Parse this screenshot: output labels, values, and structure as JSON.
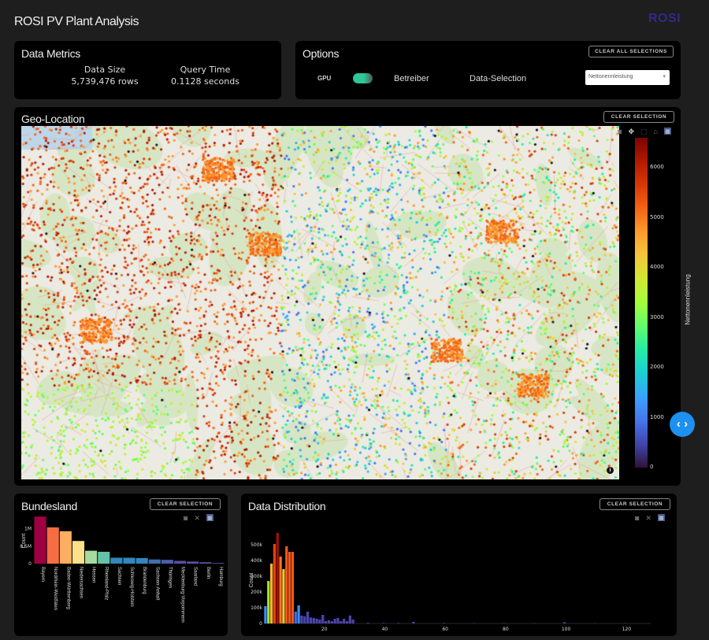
{
  "app": {
    "title": "ROSI PV Plant Analysis",
    "logo": "ROSI",
    "logo_color": "#2f2a8a"
  },
  "metrics": {
    "title": "Data Metrics",
    "data_size_label": "Data Size",
    "data_size_value": "5,739,476 rows",
    "query_time_label": "Query Time",
    "query_time_value": "0.1128 seconds"
  },
  "options": {
    "title": "Options",
    "clear_all": "CLEAR ALL SELECTIONS",
    "gpu_label": "GPU",
    "gpu_enabled": true,
    "toggle_color": "#2fc79a",
    "betreiber_label": "Betreiber",
    "data_selection_label": "Data-Selection",
    "dropdown_value": "Nettonennleistung"
  },
  "geo": {
    "title": "Geo-Location",
    "clear": "CLEAR SELECTION",
    "colorbar": {
      "title": "Nettonennleistung",
      "ticks": [
        "0",
        "1000",
        "2000",
        "3000",
        "4000",
        "5000",
        "6000"
      ],
      "range": [
        0,
        6600
      ],
      "colorscale": "turbo"
    },
    "info_icon": "info-icon"
  },
  "bundesland": {
    "title": "Bundesland",
    "clear": "CLEAR SELECTION"
  },
  "distribution": {
    "title": "Data Distribution",
    "clear": "CLEAR SELECTION"
  },
  "chart_data": [
    {
      "type": "bar",
      "title": "Bundesland",
      "ylabel": "Count",
      "ytick_labels": [
        "0",
        "0.5M",
        "1M"
      ],
      "ylim": [
        0,
        1400000
      ],
      "categories": [
        "Bayern",
        "Nordrhein-Westfalen",
        "Baden-Württemberg",
        "Niedersachsen",
        "Hessen",
        "Rheinland-Pfalz",
        "Sachsen",
        "Schleswig-Holstein",
        "Brandenburg",
        "Sachsen-Anhalt",
        "Thüringen",
        "Mecklenburg-Vorpommern",
        "Saarland",
        "Berlin",
        "Hamburg"
      ],
      "values": [
        1350000,
        1040000,
        930000,
        650000,
        370000,
        340000,
        170000,
        170000,
        160000,
        120000,
        110000,
        80000,
        60000,
        40000,
        20000
      ],
      "colors": [
        "#9e0142",
        "#f46d43",
        "#fdae61",
        "#fee08b",
        "#a6dba0",
        "#66c2a5",
        "#3288bd",
        "#3288bd",
        "#3288bd",
        "#3f6fb0",
        "#4a5fa8",
        "#5450a0",
        "#5e4fa2",
        "#5e4fa2",
        "#5e4fa2"
      ]
    },
    {
      "type": "bar",
      "title": "Data Distribution",
      "ylabel": "Count",
      "xlim": [
        0,
        128
      ],
      "ylim": [
        0,
        600000
      ],
      "xticks": [
        20,
        40,
        60,
        80,
        100,
        120
      ],
      "yticks": [
        0,
        100000,
        200000,
        300000,
        400000,
        500000
      ],
      "ytick_labels": [
        "0",
        "100k",
        "200k",
        "300k",
        "400k",
        "500k"
      ],
      "x": [
        1,
        2,
        3,
        4,
        5,
        6,
        7,
        8,
        9,
        10,
        11,
        12,
        13,
        14,
        15,
        16,
        17,
        18,
        19,
        20,
        21,
        22,
        23,
        24,
        25,
        26,
        27,
        28,
        29,
        30,
        35,
        40,
        45,
        50,
        60,
        70,
        80,
        90,
        100,
        110,
        120
      ],
      "values": [
        110000,
        270000,
        380000,
        505000,
        575000,
        425000,
        345000,
        490000,
        455000,
        455000,
        75000,
        115000,
        50000,
        45000,
        75000,
        38000,
        35000,
        30000,
        25000,
        55000,
        15000,
        20000,
        15000,
        30000,
        35000,
        15000,
        30000,
        15000,
        50000,
        25000,
        4000,
        3000,
        3000,
        10000,
        3000,
        2000,
        2000,
        2000,
        8000,
        1500,
        1500
      ]
    }
  ]
}
